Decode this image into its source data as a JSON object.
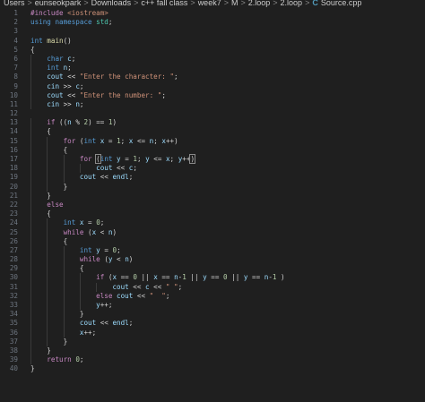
{
  "breadcrumb": [
    {
      "label": "Users",
      "icon": null
    },
    {
      "label": "eunseokpark",
      "icon": null
    },
    {
      "label": "Downloads",
      "icon": null
    },
    {
      "label": "c++ fall class",
      "icon": null
    },
    {
      "label": "week7",
      "icon": null
    },
    {
      "label": "M",
      "icon": null
    },
    {
      "label": "2.loop",
      "icon": null
    },
    {
      "label": "2.loop",
      "icon": null
    },
    {
      "label": "Source.cpp",
      "icon": "cpp-file-icon"
    }
  ],
  "breadcrumb_separator": ">",
  "file_icon_glyph": "C",
  "lines": [
    {
      "n": "1",
      "indent": 0,
      "tokens": [
        [
          "pre",
          "#include "
        ],
        [
          "str",
          "<iostream>"
        ]
      ]
    },
    {
      "n": "2",
      "indent": 0,
      "tokens": [
        [
          "kw",
          "using "
        ],
        [
          "kw",
          "namespace "
        ],
        [
          "type",
          "std"
        ],
        [
          "plain",
          ";"
        ]
      ]
    },
    {
      "n": "3",
      "indent": 0,
      "tokens": []
    },
    {
      "n": "4",
      "indent": 0,
      "tokens": [
        [
          "kw",
          "int "
        ],
        [
          "fn",
          "main"
        ],
        [
          "plain",
          "()"
        ]
      ]
    },
    {
      "n": "5",
      "indent": 0,
      "tokens": [
        [
          "plain",
          "{"
        ]
      ]
    },
    {
      "n": "6",
      "indent": 1,
      "tokens": [
        [
          "kw",
          "char "
        ],
        [
          "var",
          "c"
        ],
        [
          "plain",
          ";"
        ]
      ]
    },
    {
      "n": "7",
      "indent": 1,
      "tokens": [
        [
          "kw",
          "int "
        ],
        [
          "var",
          "n"
        ],
        [
          "plain",
          ";"
        ]
      ]
    },
    {
      "n": "8",
      "indent": 1,
      "tokens": [
        [
          "var",
          "cout "
        ],
        [
          "plain",
          "<< "
        ],
        [
          "str",
          "\"Enter the character: \""
        ],
        [
          "plain",
          ";"
        ]
      ]
    },
    {
      "n": "9",
      "indent": 1,
      "tokens": [
        [
          "var",
          "cin "
        ],
        [
          "plain",
          ">> "
        ],
        [
          "var",
          "c"
        ],
        [
          "plain",
          ";"
        ]
      ]
    },
    {
      "n": "10",
      "indent": 1,
      "tokens": [
        [
          "var",
          "cout "
        ],
        [
          "plain",
          "<< "
        ],
        [
          "str",
          "\"Enter the number: \""
        ],
        [
          "plain",
          ";"
        ]
      ]
    },
    {
      "n": "11",
      "indent": 1,
      "tokens": [
        [
          "var",
          "cin "
        ],
        [
          "plain",
          ">> "
        ],
        [
          "var",
          "n"
        ],
        [
          "plain",
          ";"
        ]
      ]
    },
    {
      "n": "12",
      "indent": 0,
      "tokens": []
    },
    {
      "n": "13",
      "indent": 1,
      "tokens": [
        [
          "ctrl",
          "if "
        ],
        [
          "plain",
          "(("
        ],
        [
          "var",
          "n "
        ],
        [
          "plain",
          "% "
        ],
        [
          "num",
          "2"
        ],
        [
          "plain",
          ") == "
        ],
        [
          "num",
          "1"
        ],
        [
          "plain",
          ")"
        ]
      ]
    },
    {
      "n": "14",
      "indent": 1,
      "tokens": [
        [
          "plain",
          "{"
        ]
      ]
    },
    {
      "n": "15",
      "indent": 2,
      "tokens": [
        [
          "ctrl",
          "for "
        ],
        [
          "plain",
          "("
        ],
        [
          "kw",
          "int "
        ],
        [
          "var",
          "x "
        ],
        [
          "plain",
          "= "
        ],
        [
          "num",
          "1"
        ],
        [
          "plain",
          "; "
        ],
        [
          "var",
          "x "
        ],
        [
          "plain",
          "<= "
        ],
        [
          "var",
          "n"
        ],
        [
          "plain",
          "; "
        ],
        [
          "var",
          "x"
        ],
        [
          "plain",
          "++)"
        ]
      ]
    },
    {
      "n": "16",
      "indent": 2,
      "tokens": [
        [
          "plain",
          "{"
        ]
      ]
    },
    {
      "n": "17",
      "indent": 3,
      "tokens": [
        [
          "ctrl",
          "for "
        ],
        [
          "box",
          "("
        ],
        [
          "kw",
          "int "
        ],
        [
          "var",
          "y "
        ],
        [
          "plain",
          "= "
        ],
        [
          "num",
          "1"
        ],
        [
          "plain",
          "; "
        ],
        [
          "var",
          "y "
        ],
        [
          "plain",
          "<= "
        ],
        [
          "var",
          "x"
        ],
        [
          "plain",
          "; "
        ],
        [
          "var",
          "y"
        ],
        [
          "plain",
          "++"
        ],
        [
          "box",
          ")"
        ]
      ]
    },
    {
      "n": "18",
      "indent": 4,
      "tokens": [
        [
          "var",
          "cout "
        ],
        [
          "plain",
          "<< "
        ],
        [
          "var",
          "c"
        ],
        [
          "plain",
          ";"
        ]
      ]
    },
    {
      "n": "19",
      "indent": 3,
      "tokens": [
        [
          "var",
          "cout "
        ],
        [
          "plain",
          "<< "
        ],
        [
          "var",
          "endl"
        ],
        [
          "plain",
          ";"
        ]
      ]
    },
    {
      "n": "20",
      "indent": 2,
      "tokens": [
        [
          "plain",
          "}"
        ]
      ]
    },
    {
      "n": "21",
      "indent": 1,
      "tokens": [
        [
          "plain",
          "}"
        ]
      ]
    },
    {
      "n": "22",
      "indent": 1,
      "tokens": [
        [
          "ctrl",
          "else"
        ]
      ]
    },
    {
      "n": "23",
      "indent": 1,
      "tokens": [
        [
          "plain",
          "{"
        ]
      ]
    },
    {
      "n": "24",
      "indent": 2,
      "tokens": [
        [
          "kw",
          "int "
        ],
        [
          "var",
          "x "
        ],
        [
          "plain",
          "= "
        ],
        [
          "num",
          "0"
        ],
        [
          "plain",
          ";"
        ]
      ]
    },
    {
      "n": "25",
      "indent": 2,
      "tokens": [
        [
          "ctrl",
          "while "
        ],
        [
          "plain",
          "("
        ],
        [
          "var",
          "x "
        ],
        [
          "plain",
          "< "
        ],
        [
          "var",
          "n"
        ],
        [
          "plain",
          ")"
        ]
      ]
    },
    {
      "n": "26",
      "indent": 2,
      "tokens": [
        [
          "plain",
          "{"
        ]
      ]
    },
    {
      "n": "27",
      "indent": 3,
      "tokens": [
        [
          "kw",
          "int "
        ],
        [
          "var",
          "y "
        ],
        [
          "plain",
          "= "
        ],
        [
          "num",
          "0"
        ],
        [
          "plain",
          ";"
        ]
      ]
    },
    {
      "n": "28",
      "indent": 3,
      "tokens": [
        [
          "ctrl",
          "while "
        ],
        [
          "plain",
          "("
        ],
        [
          "var",
          "y "
        ],
        [
          "plain",
          "< "
        ],
        [
          "var",
          "n"
        ],
        [
          "plain",
          ")"
        ]
      ]
    },
    {
      "n": "29",
      "indent": 3,
      "tokens": [
        [
          "plain",
          "{"
        ]
      ]
    },
    {
      "n": "30",
      "indent": 4,
      "tokens": [
        [
          "ctrl",
          "if "
        ],
        [
          "plain",
          "("
        ],
        [
          "var",
          "x "
        ],
        [
          "plain",
          "== "
        ],
        [
          "num",
          "0 "
        ],
        [
          "plain",
          "|| "
        ],
        [
          "var",
          "x "
        ],
        [
          "plain",
          "== "
        ],
        [
          "var",
          "n"
        ],
        [
          "plain",
          "-"
        ],
        [
          "num",
          "1 "
        ],
        [
          "plain",
          "|| "
        ],
        [
          "var",
          "y "
        ],
        [
          "plain",
          "== "
        ],
        [
          "num",
          "0 "
        ],
        [
          "plain",
          "|| "
        ],
        [
          "var",
          "y "
        ],
        [
          "plain",
          "== "
        ],
        [
          "var",
          "n"
        ],
        [
          "plain",
          "-"
        ],
        [
          "num",
          "1 "
        ],
        [
          "plain",
          ")"
        ]
      ]
    },
    {
      "n": "31",
      "indent": 5,
      "tokens": [
        [
          "var",
          "cout "
        ],
        [
          "plain",
          "<< "
        ],
        [
          "var",
          "c "
        ],
        [
          "plain",
          "<< "
        ],
        [
          "str",
          "\" \""
        ],
        [
          "plain",
          ";"
        ]
      ]
    },
    {
      "n": "32",
      "indent": 4,
      "tokens": [
        [
          "ctrl",
          "else "
        ],
        [
          "var",
          "cout "
        ],
        [
          "plain",
          "<< "
        ],
        [
          "str",
          "\"  \""
        ],
        [
          "plain",
          ";"
        ]
      ]
    },
    {
      "n": "33",
      "indent": 4,
      "tokens": [
        [
          "var",
          "y"
        ],
        [
          "plain",
          "++;"
        ]
      ]
    },
    {
      "n": "34",
      "indent": 3,
      "tokens": [
        [
          "plain",
          "}"
        ]
      ]
    },
    {
      "n": "35",
      "indent": 3,
      "tokens": [
        [
          "var",
          "cout "
        ],
        [
          "plain",
          "<< "
        ],
        [
          "var",
          "endl"
        ],
        [
          "plain",
          ";"
        ]
      ]
    },
    {
      "n": "36",
      "indent": 3,
      "tokens": [
        [
          "var",
          "x"
        ],
        [
          "plain",
          "++;"
        ]
      ]
    },
    {
      "n": "37",
      "indent": 2,
      "tokens": [
        [
          "plain",
          "}"
        ]
      ]
    },
    {
      "n": "38",
      "indent": 1,
      "tokens": [
        [
          "plain",
          "}"
        ]
      ]
    },
    {
      "n": "39",
      "indent": 1,
      "tokens": [
        [
          "ctrl",
          "return "
        ],
        [
          "num",
          "0"
        ],
        [
          "plain",
          ";"
        ]
      ]
    },
    {
      "n": "40",
      "indent": 0,
      "tokens": [
        [
          "plain",
          "}"
        ]
      ]
    }
  ]
}
